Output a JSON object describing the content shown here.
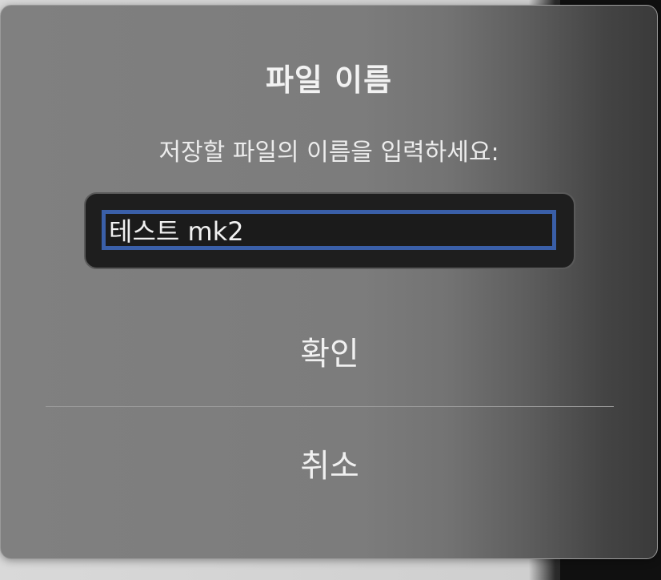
{
  "dialog": {
    "title": "파일 이름",
    "message": "저장할 파일의 이름을 입력하세요:",
    "filename_value": "테스트 mk2",
    "ok_label": "확인",
    "cancel_label": "취소"
  },
  "colors": {
    "field_focus_ring": "#3a5fa8",
    "field_background": "#1b1b1b"
  }
}
